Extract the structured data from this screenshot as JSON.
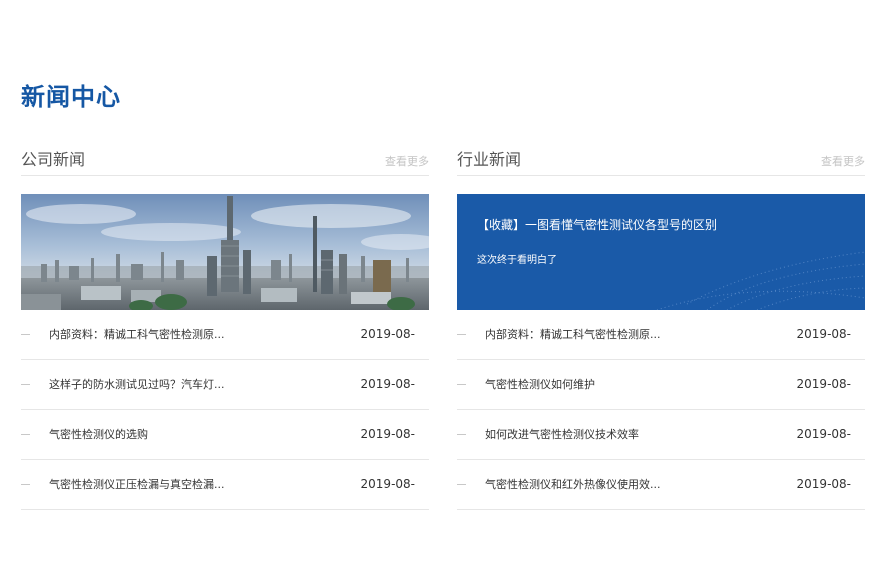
{
  "page_title": "新闻中心",
  "company": {
    "title": "公司新闻",
    "more": "查看更多",
    "items": [
      {
        "title": "内部资料：精诚工科气密性检测原...",
        "date": "2019-08-"
      },
      {
        "title": "这样子的防水测试见过吗？汽车灯...",
        "date": "2019-08-"
      },
      {
        "title": "气密性检测仪的选购",
        "date": "2019-08-"
      },
      {
        "title": "气密性检测仪正压检漏与真空检漏...",
        "date": "2019-08-"
      }
    ]
  },
  "industry": {
    "title": "行业新闻",
    "more": "查看更多",
    "featured_title": "【收藏】一图看懂气密性测试仪各型号的区别",
    "featured_subtitle": "这次终于看明白了",
    "items": [
      {
        "title": "内部资料：精诚工科气密性检测原...",
        "date": "2019-08-"
      },
      {
        "title": "气密性检测仪如何维护",
        "date": "2019-08-"
      },
      {
        "title": "如何改进气密性检测仪技术效率",
        "date": "2019-08-"
      },
      {
        "title": "气密性检测仪和红外热像仪使用效...",
        "date": "2019-08-"
      }
    ]
  },
  "colors": {
    "accent": "#1557a4",
    "banner_blue": "#1a5aa8"
  }
}
